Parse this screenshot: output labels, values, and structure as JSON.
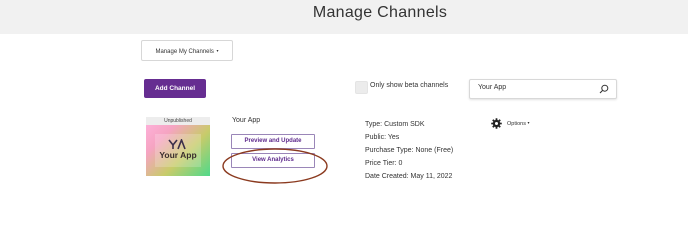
{
  "header": {
    "title": "Manage Channels"
  },
  "filter": {
    "dropdown_label": "Manage My Channels",
    "caret": "▾"
  },
  "toolbar": {
    "add_channel_label": "Add Channel",
    "beta_label": "Only show beta channels",
    "beta_checked": false
  },
  "search": {
    "value": "Your App",
    "icon": "search-icon"
  },
  "channel": {
    "thumbnail_status": "Unpublished",
    "thumbnail_name": "Your App",
    "name": "Your App",
    "preview_label": "Preview and Update",
    "analytics_label": "View Analytics",
    "details": [
      "Type: Custom SDK",
      "Public: Yes",
      "Purchase Type: None (Free)",
      "Price Tier: 0",
      "Date Created: May 11, 2022"
    ],
    "options_label": "Options",
    "options_caret": "▾"
  },
  "colors": {
    "brand_purple": "#662d91",
    "header_band": "#f1f1f1",
    "highlight_ring": "#8b3a1f"
  }
}
